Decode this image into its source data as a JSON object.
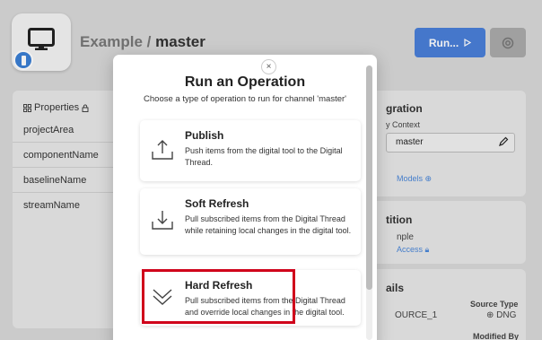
{
  "header": {
    "project": "Example",
    "separator": " / ",
    "branch": "master",
    "run_label": "Run...",
    "run_icon": "play-outline-icon",
    "settings_icon": "gear-icon"
  },
  "properties": {
    "title": "Properties",
    "items": [
      "projectArea",
      "componentName",
      "baselineName",
      "streamName"
    ]
  },
  "right_panels": {
    "integration_title": "gration",
    "context_label": "y Context",
    "context_value": "master",
    "models_link": "Models",
    "partition_title": "tition",
    "partition_value": "nple",
    "access_link": "Access",
    "details_title": "ails",
    "source_type_label": "Source Type",
    "source_value": "OURCE_1",
    "source_type_value": "DNG",
    "modified_by_label": "Modified By"
  },
  "modal": {
    "title": "Run an Operation",
    "subtitle": "Choose a type of operation to run for channel 'master'",
    "close_label": "×",
    "operations": [
      {
        "name": "Publish",
        "description": "Push items from the digital tool to the Digital Thread.",
        "icon": "upload-icon"
      },
      {
        "name": "Soft Refresh",
        "description": "Pull subscribed items from the Digital Thread while retaining local changes in the digital tool.",
        "icon": "download-icon"
      },
      {
        "name": "Hard Refresh",
        "description": "Pull subscribed items from the Digital Thread and override local changes in the digital tool.",
        "icon": "double-chevron-down-icon"
      }
    ]
  },
  "colors": {
    "accent": "#4a7fd8",
    "highlight": "#d0021b"
  }
}
